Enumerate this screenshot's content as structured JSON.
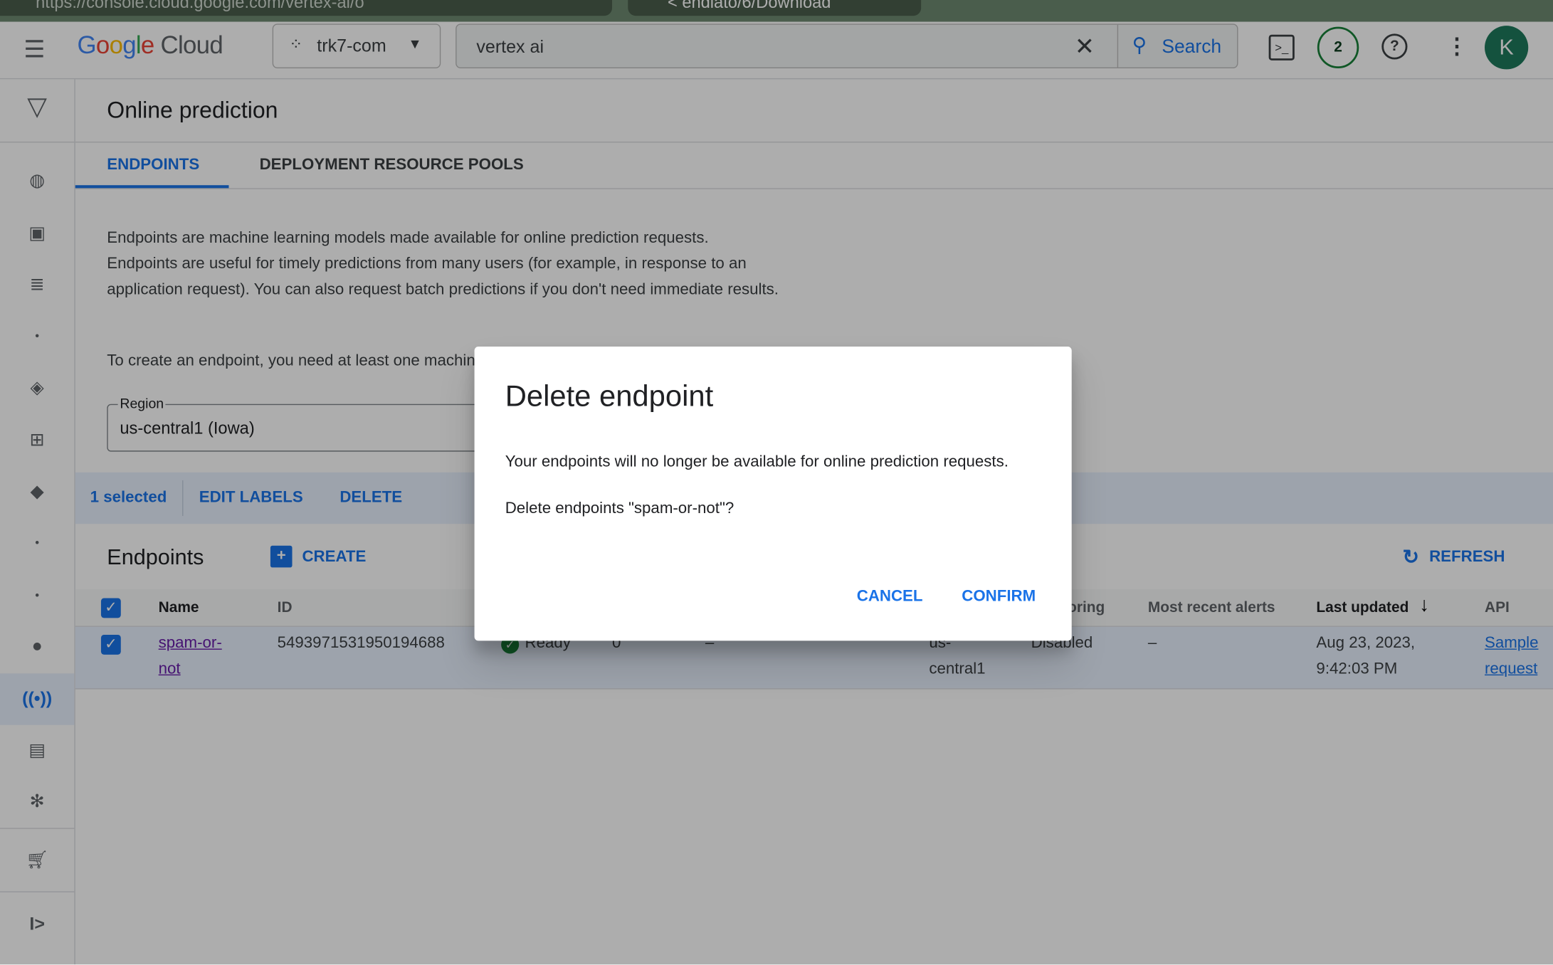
{
  "browser": {
    "url": "https://console.cloud.google.com/vertex-ai/o",
    "tab": "< endlato/6/Download"
  },
  "topbar": {
    "logo": "Google Cloud",
    "project": "trk7-com",
    "search_value": "vertex ai",
    "search_label": "Search",
    "notifications_count": "2",
    "avatar_letter": "K"
  },
  "sidebar": {
    "icons": [
      "vertex-ai-logo",
      "globe-sparkle-icon",
      "image-sparkle-icon",
      "text-sparkle-icon",
      "dot",
      "layers-icon",
      "grid-icon",
      "tag-icon",
      "dot",
      "dot",
      "lightbulb-icon",
      "endpoint-icon",
      "batch-icon",
      "hub-icon",
      "marketplace-icon",
      "expand-icon"
    ],
    "active": "endpoint-icon"
  },
  "page": {
    "title": "Online prediction",
    "tabs": [
      {
        "label": "ENDPOINTS",
        "active": true
      },
      {
        "label": "DEPLOYMENT RESOURCE POOLS",
        "active": false
      }
    ],
    "description": "Endpoints are machine learning models made available for online prediction requests. Endpoints are useful for timely predictions from many users (for example, in response to an application request). You can also request batch predictions if you don't need immediate results.",
    "create_note": "To create an endpoint, you need at least one machine learning model.",
    "region_label": "Region",
    "region_value": "us-central1 (Iowa)"
  },
  "selection_bar": {
    "count": "1 selected",
    "edit_labels": "EDIT LABELS",
    "delete": "DELETE"
  },
  "endpoints": {
    "heading": "Endpoints",
    "create": "CREATE",
    "refresh": "REFRESH",
    "columns": [
      "Name",
      "ID",
      "Monitoring",
      "Most recent alerts",
      "Last updated",
      "API"
    ],
    "rows": [
      {
        "name": "spam-or-not",
        "id": "5493971531950194688",
        "status": "Ready",
        "models": "0",
        "col5": "–",
        "region": "us-central1",
        "monitoring": "Disabled",
        "alerts": "–",
        "last_updated": "Aug 23, 2023, 9:42:03 PM",
        "api": "Sample request",
        "selected": true
      }
    ]
  },
  "dialog": {
    "title": "Delete endpoint",
    "message": "Your endpoints will no longer be available for online prediction requests.",
    "question": "Delete endpoints \"spam-or-not\"?",
    "cancel": "CANCEL",
    "confirm": "CONFIRM"
  },
  "colors": {
    "accent": "#1a73e8",
    "ready": "#188038",
    "avatar": "#1e7a5c"
  }
}
